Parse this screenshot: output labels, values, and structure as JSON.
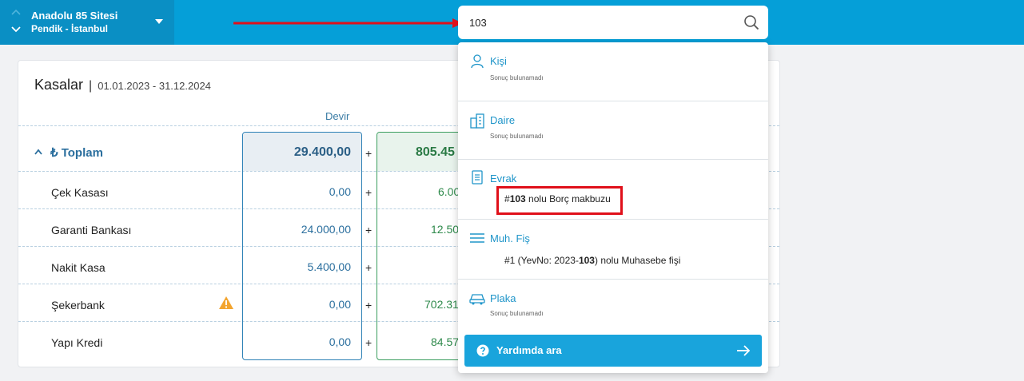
{
  "site": {
    "name": "Anadolu 85 Sitesi",
    "location": "Pendik - İstanbul"
  },
  "search": {
    "value": "103"
  },
  "card": {
    "title": "Kasalar",
    "separator": "|",
    "date_range": "01.01.2023 - 31.12.2024",
    "column_header": "Devir",
    "total": {
      "label": "₺ Toplam",
      "devir": "29.400,00",
      "second": "805.45"
    },
    "rows": [
      {
        "label": "Çek Kasası",
        "devir": "0,00",
        "second": "6.00"
      },
      {
        "label": "Garanti Bankası",
        "devir": "24.000,00",
        "second": "12.50"
      },
      {
        "label": "Nakit Kasa",
        "devir": "5.400,00",
        "second": ""
      },
      {
        "label": "Şekerbank",
        "devir": "0,00",
        "second": "702.31"
      },
      {
        "label": "Yapı Kredi",
        "devir": "0,00",
        "second": "84.57"
      }
    ],
    "plus": "+"
  },
  "dropdown": {
    "kisi": {
      "title": "Kişi",
      "empty": "Sonuç bulunamadı"
    },
    "daire": {
      "title": "Daire",
      "empty": "Sonuç bulunamadı"
    },
    "evrak": {
      "title": "Evrak",
      "result_prefix": "#",
      "result_bold": "103",
      "result_suffix": " nolu Borç makbuzu"
    },
    "muhfis": {
      "title": "Muh. Fiş",
      "result_prefix": "#1 (YevNo: 2023-",
      "result_bold": "103",
      "result_suffix": ") nolu Muhasebe fişi"
    },
    "plaka": {
      "title": "Plaka",
      "empty": "Sonuç bulunamadı"
    },
    "help_label": "Yardımda ara"
  },
  "colors": {
    "topbar": "#059fd8",
    "accent": "#1f95c9",
    "highlight": "#e0101a",
    "positive": "#2f8a4c"
  }
}
